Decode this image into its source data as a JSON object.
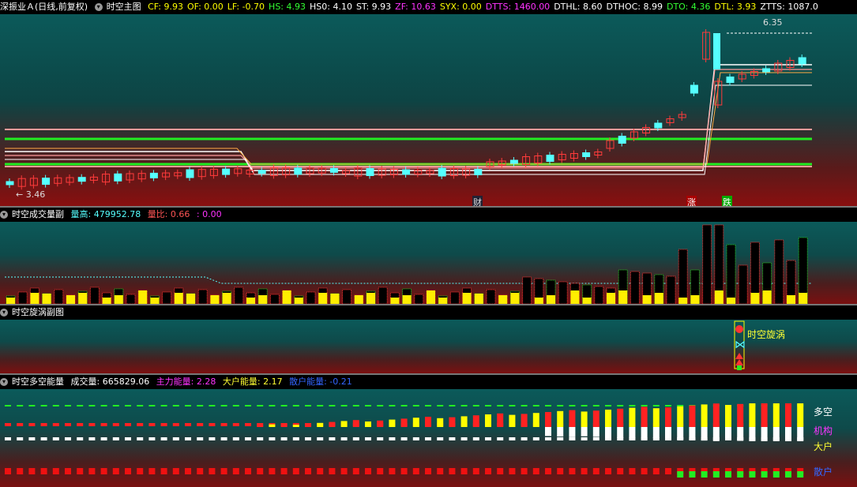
{
  "main": {
    "stock": "深振业Ａ",
    "period": "(日线,前复权)",
    "indicator": "时空主图",
    "values": [
      {
        "label": "CF: 9.93",
        "color": "#ffff00"
      },
      {
        "label": "OF: 0.00",
        "color": "#ffff00"
      },
      {
        "label": "LF: -0.70",
        "color": "#ffff00"
      },
      {
        "label": "HS: 4.93",
        "color": "#33ff33"
      },
      {
        "label": "HS0: 4.10",
        "color": "#ffffff"
      },
      {
        "label": "ST: 9.93",
        "color": "#ffffff"
      },
      {
        "label": "ZF: 10.63",
        "color": "#ff33ff"
      },
      {
        "label": "SYX: 0.00",
        "color": "#ffff00"
      },
      {
        "label": "DTTS: 1460.00",
        "color": "#ff33ff"
      },
      {
        "label": "DTHL: 8.60",
        "color": "#ffffff"
      },
      {
        "label": "DTHOC: 8.99",
        "color": "#ffffff"
      },
      {
        "label": "DTO: 4.36",
        "color": "#33ff33"
      },
      {
        "label": "DTL: 3.93",
        "color": "#ffff00"
      },
      {
        "label": "ZTTS: 1087.0",
        "color": "#ffffff"
      }
    ],
    "high_label": "6.35",
    "low_label": "3.46",
    "tags": [
      "财",
      "涨",
      "跌"
    ]
  },
  "volume": {
    "title": "时空成交量副",
    "v1": "量高: 479952.78",
    "v2": "量比: 0.66",
    "v3": ": 0.00"
  },
  "vortex": {
    "title": "时空旋涡副图",
    "signal": "时空旋涡"
  },
  "energy": {
    "title": "时空多空能量",
    "v1": "成交量: 665829.06",
    "v2": "主力能量: 2.28",
    "v3": "大户能量: 2.17",
    "v4": "散户能量: -0.21",
    "legend": [
      {
        "label": "多空",
        "color": "#ffffff"
      },
      {
        "label": "机构",
        "color": "#ff33ff"
      },
      {
        "label": "大户",
        "color": "#ffff00"
      },
      {
        "label": "散户",
        "color": "#3366ff"
      }
    ]
  },
  "colors": {
    "up": "#ff3b3b",
    "down": "#55ffff",
    "line_green": "#22ee22",
    "line_pink": "#ff9a9a",
    "vol_yellow": "#ffee00",
    "white": "#ffffff"
  }
}
